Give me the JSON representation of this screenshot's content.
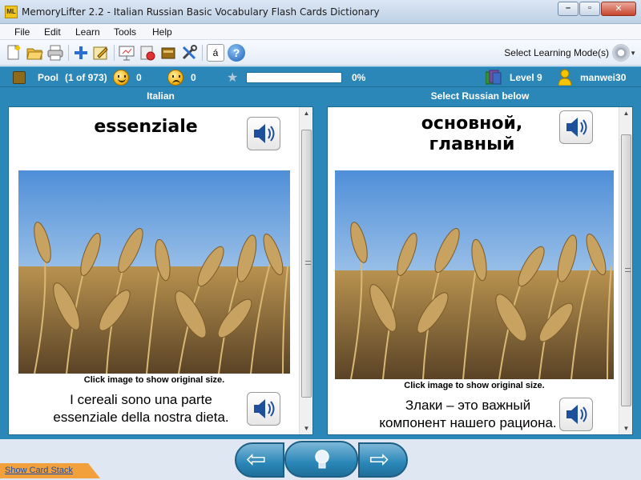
{
  "window": {
    "app_icon_text": "ML",
    "title": "MemoryLifter 2.2 - Italian Russian Basic Vocabulary Flash Cards Dictionary",
    "min_glyph": "–",
    "max_glyph": "▫",
    "close_glyph": "✕"
  },
  "menu": [
    "File",
    "Edit",
    "Learn",
    "Tools",
    "Help"
  ],
  "toolbar": {
    "icons": [
      "new-file",
      "open-folder",
      "print",
      "add-card",
      "edit-card",
      "presentation",
      "statistics",
      "cards-box",
      "settings-tools",
      "special-char",
      "help"
    ],
    "special_char": "á",
    "help_glyph": "?",
    "mode_label": "Select Learning Mode(s)"
  },
  "status": {
    "pool_label": "Pool",
    "pool_count": "(1 of 973)",
    "correct_count": "0",
    "wrong_count": "0",
    "progress_percent": 0,
    "progress_text": "0%",
    "level": "Level 9",
    "user": "manwei30"
  },
  "left_panel": {
    "header": "Italian",
    "word": "essenziale",
    "caption": "Click image to show original size.",
    "sentence": "I cereali sono una parte essenziale della nostra dieta."
  },
  "right_panel": {
    "header": "Select Russian below",
    "word": "основной, главный",
    "caption": "Click image to show original size.",
    "sentence": "Злаки – это важный компонент нашего рациона."
  },
  "bottom": {
    "link": "Show Card Stack",
    "prev_glyph": "⇦",
    "hint_icon": "lightbulb",
    "next_glyph": "⇨"
  },
  "colors": {
    "accent": "#2a87b8",
    "tab": "#f2a03b"
  }
}
